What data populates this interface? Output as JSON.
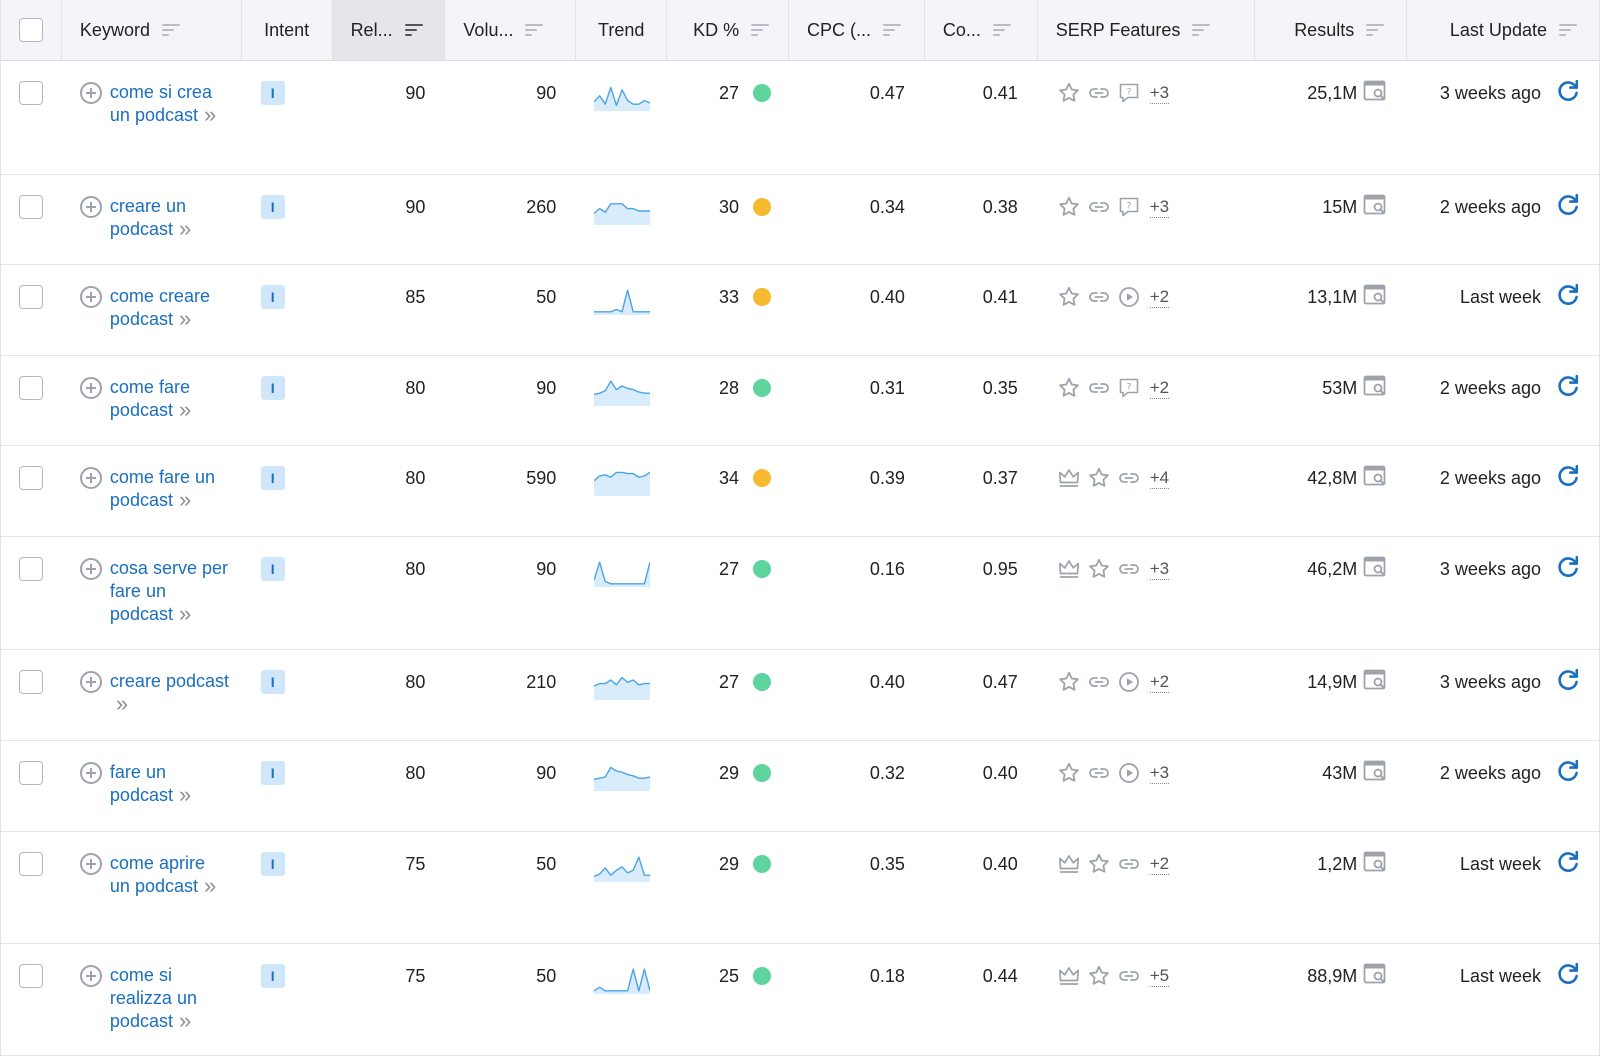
{
  "columns": {
    "keyword": "Keyword",
    "intent": "Intent",
    "relevance": "Rel...",
    "volume": "Volu...",
    "trend": "Trend",
    "kd": "KD %",
    "cpc": "CPC (...",
    "competition": "Co...",
    "serp": "SERP Features",
    "results": "Results",
    "last_update": "Last Update"
  },
  "colors": {
    "link": "#1a6fbf",
    "kd_easy": "#5dd39e",
    "kd_medium": "#f7b92f",
    "intent_bg": "#cfe6fb"
  },
  "rows": [
    {
      "keyword": "come si crea un podcast",
      "intent": "I",
      "rel": "90",
      "vol": "90",
      "trend": [
        0.3,
        0.55,
        0.2,
        0.9,
        0.15,
        0.8,
        0.35,
        0.2,
        0.2,
        0.35,
        0.25
      ],
      "kd": "27",
      "kd_level": "easy",
      "cpc": "0.47",
      "com": "0.41",
      "serp": [
        "star-icon",
        "link-icon",
        "faq-icon"
      ],
      "serp_more": "+3",
      "results": "25,1M",
      "update": "3 weeks ago"
    },
    {
      "keyword": "creare un podcast",
      "intent": "I",
      "rel": "90",
      "vol": "260",
      "trend": [
        0.4,
        0.6,
        0.45,
        0.8,
        0.8,
        0.8,
        0.6,
        0.6,
        0.5,
        0.5,
        0.5
      ],
      "kd": "30",
      "kd_level": "medium",
      "cpc": "0.34",
      "com": "0.38",
      "serp": [
        "star-icon",
        "link-icon",
        "faq-icon"
      ],
      "serp_more": "+3",
      "results": "15M",
      "update": "2 weeks ago"
    },
    {
      "keyword": "come creare podcast",
      "intent": "I",
      "rel": "85",
      "vol": "50",
      "trend": [
        0.05,
        0.05,
        0.05,
        0.05,
        0.15,
        0.05,
        0.95,
        0.05,
        0.05,
        0.05,
        0.05
      ],
      "kd": "33",
      "kd_level": "medium",
      "cpc": "0.40",
      "com": "0.41",
      "serp": [
        "star-icon",
        "link-icon",
        "video-icon"
      ],
      "serp_more": "+2",
      "results": "13,1M",
      "update": "Last week"
    },
    {
      "keyword": "come fare podcast",
      "intent": "I",
      "rel": "80",
      "vol": "90",
      "trend": [
        0.4,
        0.45,
        0.55,
        0.95,
        0.6,
        0.75,
        0.65,
        0.6,
        0.5,
        0.45,
        0.45
      ],
      "kd": "28",
      "kd_level": "easy",
      "cpc": "0.31",
      "com": "0.35",
      "serp": [
        "star-icon",
        "link-icon",
        "faq-icon"
      ],
      "serp_more": "+2",
      "results": "53M",
      "update": "2 weeks ago"
    },
    {
      "keyword": "come fare un podcast",
      "intent": "I",
      "rel": "80",
      "vol": "590",
      "trend": [
        0.55,
        0.75,
        0.8,
        0.7,
        0.9,
        0.9,
        0.85,
        0.85,
        0.7,
        0.75,
        0.9
      ],
      "kd": "34",
      "kd_level": "medium",
      "cpc": "0.39",
      "com": "0.37",
      "serp": [
        "crown-icon",
        "star-icon",
        "link-icon"
      ],
      "serp_more": "+4",
      "results": "42,8M",
      "update": "2 weeks ago"
    },
    {
      "keyword": "cosa serve per fare un podcast",
      "intent": "I",
      "rel": "80",
      "vol": "90",
      "trend": [
        0.2,
        0.95,
        0.15,
        0.05,
        0.05,
        0.05,
        0.05,
        0.05,
        0.05,
        0.05,
        0.95
      ],
      "kd": "27",
      "kd_level": "easy",
      "cpc": "0.16",
      "com": "0.95",
      "serp": [
        "crown-icon",
        "star-icon",
        "link-icon"
      ],
      "serp_more": "+3",
      "results": "46,2M",
      "update": "3 weeks ago"
    },
    {
      "keyword": "creare podcast",
      "intent": "I",
      "rel": "80",
      "vol": "210",
      "trend": [
        0.5,
        0.6,
        0.6,
        0.75,
        0.55,
        0.85,
        0.65,
        0.75,
        0.55,
        0.6,
        0.6
      ],
      "kd": "27",
      "kd_level": "easy",
      "cpc": "0.40",
      "com": "0.47",
      "serp": [
        "star-icon",
        "link-icon",
        "video-icon"
      ],
      "serp_more": "+2",
      "results": "14,9M",
      "update": "3 weeks ago"
    },
    {
      "keyword": "fare un podcast",
      "intent": "I",
      "rel": "80",
      "vol": "90",
      "trend": [
        0.4,
        0.45,
        0.5,
        0.9,
        0.75,
        0.7,
        0.6,
        0.55,
        0.45,
        0.45,
        0.5
      ],
      "kd": "29",
      "kd_level": "easy",
      "cpc": "0.32",
      "com": "0.40",
      "serp": [
        "star-icon",
        "link-icon",
        "video-icon"
      ],
      "serp_more": "+3",
      "results": "43M",
      "update": "2 weeks ago"
    },
    {
      "keyword": "come aprire un podcast",
      "intent": "I",
      "rel": "75",
      "vol": "50",
      "trend": [
        0.15,
        0.25,
        0.5,
        0.2,
        0.4,
        0.55,
        0.3,
        0.4,
        0.95,
        0.2,
        0.2
      ],
      "kd": "29",
      "kd_level": "easy",
      "cpc": "0.35",
      "com": "0.40",
      "serp": [
        "crown-icon",
        "star-icon",
        "link-icon"
      ],
      "serp_more": "+2",
      "results": "1,2M",
      "update": "Last week"
    },
    {
      "keyword": "come si realizza un podcast",
      "intent": "I",
      "rel": "75",
      "vol": "50",
      "trend": [
        0.05,
        0.2,
        0.05,
        0.05,
        0.05,
        0.05,
        0.05,
        0.95,
        0.05,
        0.95,
        0.05
      ],
      "kd": "25",
      "kd_level": "easy",
      "cpc": "0.18",
      "com": "0.44",
      "serp": [
        "crown-icon",
        "star-icon",
        "link-icon"
      ],
      "serp_more": "+5",
      "results": "88,9M",
      "update": "Last week"
    }
  ]
}
